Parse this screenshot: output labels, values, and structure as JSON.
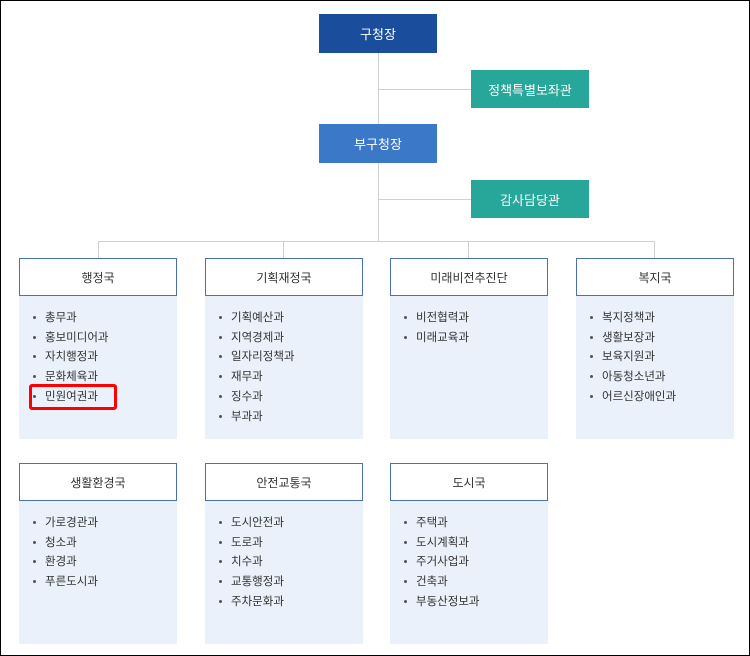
{
  "org": {
    "mayor": "구청장",
    "policy_advisor": "정책특별보좌관",
    "deputy": "부구청장",
    "audit": "감사담당관"
  },
  "colors": {
    "mayor_bg": "#1a4d9c",
    "deputy_bg": "#3c78c8",
    "teal_bg": "#27a69a",
    "highlight": "#ff0000"
  },
  "departments": [
    {
      "name": "행정국",
      "items": [
        "총무과",
        "홍보미디어과",
        "자치행정과",
        "문화체육과",
        "민원여권과"
      ]
    },
    {
      "name": "기획재정국",
      "items": [
        "기획예산과",
        "지역경제과",
        "일자리정책과",
        "재무과",
        "징수과",
        "부과과"
      ]
    },
    {
      "name": "미래비전추진단",
      "items": [
        "비전협력과",
        "미래교육과"
      ]
    },
    {
      "name": "복지국",
      "items": [
        "복지정책과",
        "생활보장과",
        "보육지원과",
        "아동청소년과",
        "어르신장애인과"
      ]
    },
    {
      "name": "생활환경국",
      "items": [
        "가로경관과",
        "청소과",
        "환경과",
        "푸른도시과"
      ]
    },
    {
      "name": "안전교통국",
      "items": [
        "도시안전과",
        "도로과",
        "치수과",
        "교통행정과",
        "주차문화과"
      ]
    },
    {
      "name": "도시국",
      "items": [
        "주택과",
        "도시계획과",
        "주거사업과",
        "건축과",
        "부동산정보과"
      ]
    }
  ]
}
